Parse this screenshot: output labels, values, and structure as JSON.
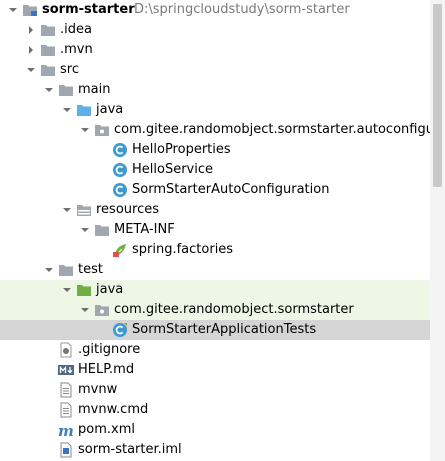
{
  "project": {
    "name": "sorm-starter",
    "path": "D:\\springcloudstudy\\sorm-starter"
  },
  "tree": [
    {
      "label": "sorm-starter",
      "depth": 0,
      "arrow": "down",
      "icon": "module-folder-icon",
      "bold": true,
      "name": "tree-item-sorm-starter"
    },
    {
      "label": ".idea",
      "depth": 1,
      "arrow": "right",
      "icon": "folder-icon",
      "name": "tree-item-idea"
    },
    {
      "label": ".mvn",
      "depth": 1,
      "arrow": "right",
      "icon": "folder-icon",
      "name": "tree-item-mvn"
    },
    {
      "label": "src",
      "depth": 1,
      "arrow": "down",
      "icon": "folder-icon",
      "name": "tree-item-src"
    },
    {
      "label": "main",
      "depth": 2,
      "arrow": "down",
      "icon": "folder-icon",
      "name": "tree-item-main"
    },
    {
      "label": "java",
      "depth": 3,
      "arrow": "down",
      "icon": "source-root-folder-icon",
      "name": "tree-item-main-java"
    },
    {
      "label": "com.gitee.randomobject.sormstarter.autoconfigure",
      "depth": 4,
      "arrow": "down",
      "icon": "package-icon",
      "name": "tree-item-package-autoconfigure"
    },
    {
      "label": "HelloProperties",
      "depth": 5,
      "arrow": "none",
      "icon": "java-class-icon",
      "name": "tree-item-hello-properties"
    },
    {
      "label": "HelloService",
      "depth": 5,
      "arrow": "none",
      "icon": "java-class-icon",
      "name": "tree-item-hello-service"
    },
    {
      "label": "SormStarterAutoConfiguration",
      "depth": 5,
      "arrow": "none",
      "icon": "java-class-icon",
      "name": "tree-item-sorm-starter-auto-configuration"
    },
    {
      "label": "resources",
      "depth": 3,
      "arrow": "down",
      "icon": "resources-folder-icon",
      "name": "tree-item-resources"
    },
    {
      "label": "META-INF",
      "depth": 4,
      "arrow": "down",
      "icon": "folder-icon",
      "name": "tree-item-meta-inf"
    },
    {
      "label": "spring.factories",
      "depth": 5,
      "arrow": "none",
      "icon": "spring-file-icon",
      "name": "tree-item-spring-factories"
    },
    {
      "label": "test",
      "depth": 2,
      "arrow": "down",
      "icon": "folder-icon",
      "name": "tree-item-test"
    },
    {
      "label": "java",
      "depth": 3,
      "arrow": "down",
      "icon": "test-root-folder-icon",
      "name": "tree-item-test-java",
      "rowStyle": "test-src"
    },
    {
      "label": "com.gitee.randomobject.sormstarter",
      "depth": 4,
      "arrow": "down",
      "icon": "package-icon",
      "name": "tree-item-package-sormstarter",
      "rowStyle": "test-src"
    },
    {
      "label": "SormStarterApplicationTests",
      "depth": 5,
      "arrow": "none",
      "icon": "java-test-class-icon",
      "name": "tree-item-sorm-starter-application-tests",
      "rowStyle": "selected"
    },
    {
      "label": ".gitignore",
      "depth": 2,
      "arrow": "none",
      "icon": "gitignore-file-icon",
      "name": "tree-item-gitignore"
    },
    {
      "label": "HELP.md",
      "depth": 2,
      "arrow": "none",
      "icon": "markdown-file-icon",
      "name": "tree-item-help-md"
    },
    {
      "label": "mvnw",
      "depth": 2,
      "arrow": "none",
      "icon": "text-file-icon",
      "name": "tree-item-mvnw"
    },
    {
      "label": "mvnw.cmd",
      "depth": 2,
      "arrow": "none",
      "icon": "text-file-icon",
      "name": "tree-item-mvnw-cmd"
    },
    {
      "label": "pom.xml",
      "depth": 2,
      "arrow": "none",
      "icon": "maven-file-icon",
      "name": "tree-item-pom-xml"
    },
    {
      "label": "sorm-starter.iml",
      "depth": 2,
      "arrow": "none",
      "icon": "module-file-icon",
      "name": "tree-item-sorm-starter-iml"
    }
  ],
  "colors": {
    "folder": "#a0a7b1",
    "source_root": "#5fb0e8",
    "test_root": "#6eaf40",
    "class_circle": "#3d9ad1",
    "test_row": "#eef7e6",
    "selected_row": "#d5d5d5",
    "path_text": "#7a7a7a"
  }
}
